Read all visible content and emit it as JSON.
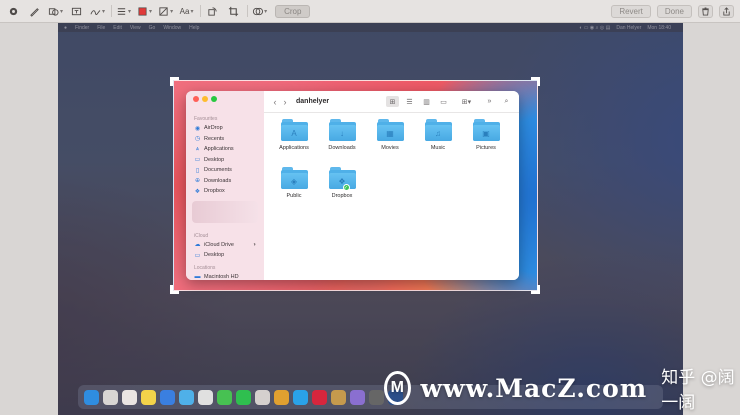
{
  "toolbar": {
    "tools": [
      {
        "icon": "sketch-icon"
      },
      {
        "icon": "draw-icon"
      },
      {
        "icon": "shapes-icon"
      },
      {
        "icon": "text-box-icon"
      },
      {
        "icon": "sign-icon"
      },
      {
        "icon": "shape-style-icon"
      },
      {
        "icon": "border-color-icon",
        "color": "#e03a3a"
      },
      {
        "icon": "fill-color-icon"
      },
      {
        "icon": "text-style-icon",
        "label": "Aa"
      },
      {
        "icon": "rotate-icon"
      },
      {
        "icon": "crop-icon"
      },
      {
        "icon": "annotate-icon"
      }
    ],
    "crop_label": "Crop",
    "revert_label": "Revert",
    "done_label": "Done"
  },
  "desktop": {
    "menubar_left": [
      "Finder",
      "File",
      "Edit",
      "View",
      "Go",
      "Window",
      "Help"
    ],
    "menubar_right": [
      "Dan Helyer",
      "Mon 18:40"
    ]
  },
  "finder": {
    "title": "danhelyer",
    "sidebar": {
      "favourites_label": "Favourites",
      "favourites": [
        {
          "label": "AirDrop",
          "icon": "airdrop-icon"
        },
        {
          "label": "Recents",
          "icon": "clock-icon"
        },
        {
          "label": "Applications",
          "icon": "applications-icon"
        },
        {
          "label": "Desktop",
          "icon": "desktop-icon"
        },
        {
          "label": "Documents",
          "icon": "document-icon"
        },
        {
          "label": "Downloads",
          "icon": "download-icon"
        },
        {
          "label": "Dropbox",
          "icon": "dropbox-icon"
        }
      ],
      "icloud_label": "iCloud",
      "icloud": [
        {
          "label": "iCloud Drive",
          "icon": "cloud-icon"
        },
        {
          "label": "Desktop",
          "icon": "desktop-icon"
        }
      ],
      "locations_label": "Locations",
      "locations": [
        {
          "label": "Macintosh HD",
          "icon": "disk-icon"
        }
      ]
    },
    "items": [
      {
        "label": "Applications",
        "icon": "applications-folder-icon",
        "glyph": "A"
      },
      {
        "label": "Downloads",
        "icon": "downloads-folder-icon",
        "glyph": "↓"
      },
      {
        "label": "Movies",
        "icon": "movies-folder-icon",
        "glyph": "▦"
      },
      {
        "label": "Music",
        "icon": "music-folder-icon",
        "glyph": "♫"
      },
      {
        "label": "Pictures",
        "icon": "pictures-folder-icon",
        "glyph": "▣"
      },
      {
        "label": "Public",
        "icon": "public-folder-icon",
        "glyph": "◈"
      },
      {
        "label": "Dropbox",
        "icon": "dropbox-folder-icon",
        "glyph": "❖",
        "synced": true
      }
    ]
  },
  "watermark": {
    "logo": "M",
    "text": "www.MacZ.com",
    "zh": "知乎 @阔一阔"
  }
}
